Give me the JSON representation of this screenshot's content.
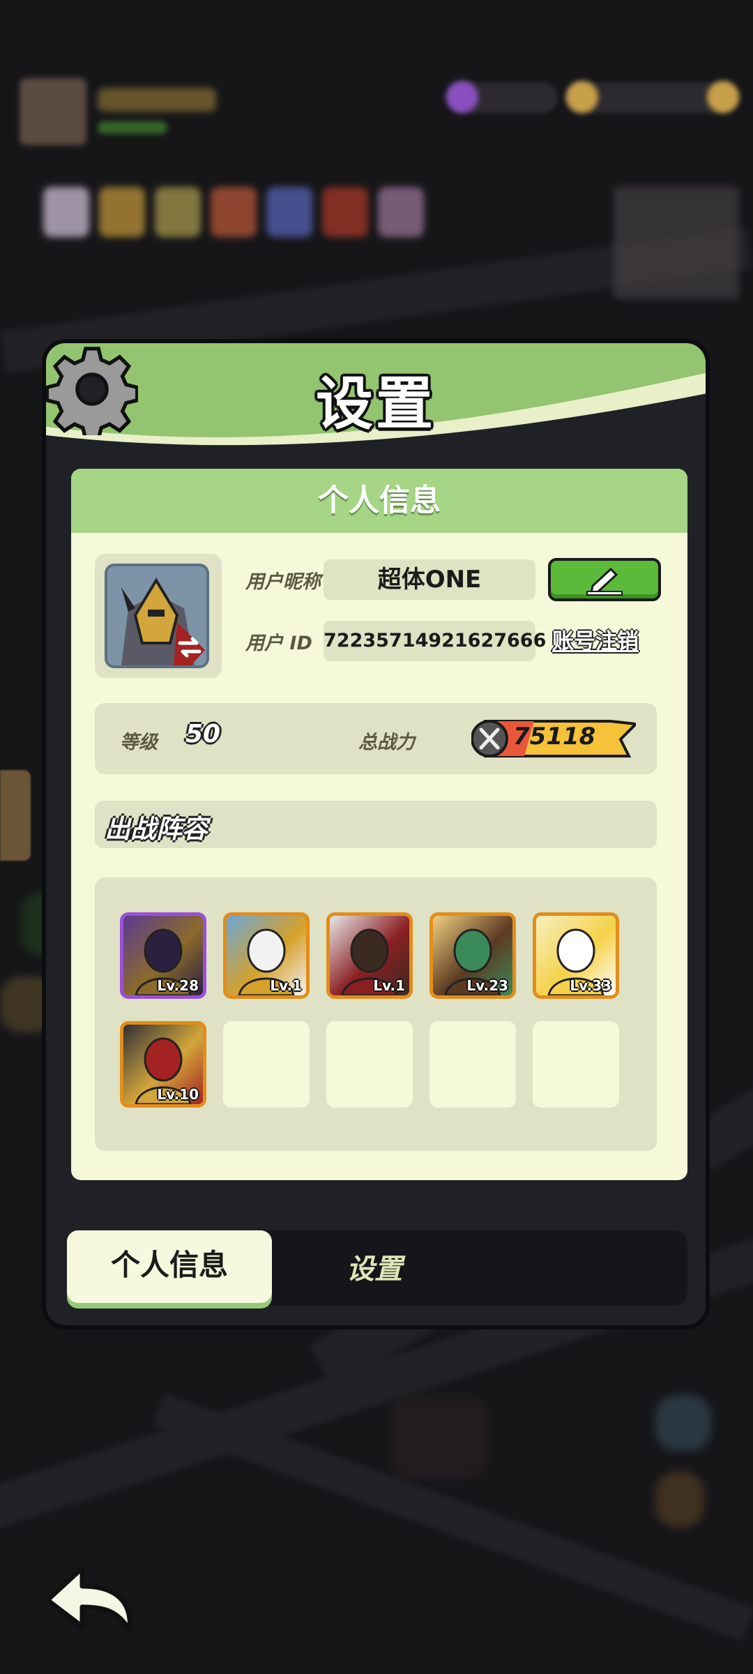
{
  "panel": {
    "title": "设置",
    "section_header": "个人信息"
  },
  "profile": {
    "nickname_label": "用户昵称",
    "nickname_value": "超体ONE",
    "id_label": "用户  ID",
    "id_value": "72235714921627666",
    "deactivate_label": "账号注销"
  },
  "stats": {
    "level_label": "等级",
    "level_value": "50",
    "power_label": "总战力",
    "power_value": "75118"
  },
  "lineup": {
    "title": "出战阵容",
    "heroes": [
      {
        "level": "Lv.28",
        "rarity": "epic",
        "palette": [
          "#5b3a8f",
          "#8b6a2b",
          "#2b2040"
        ]
      },
      {
        "level": "Lv.1",
        "rarity": "legendary",
        "palette": [
          "#6aa7d8",
          "#d6a12a",
          "#f2f2f2"
        ]
      },
      {
        "level": "Lv.1",
        "rarity": "legendary",
        "palette": [
          "#e8e8e8",
          "#8a1f22",
          "#3a2a22"
        ]
      },
      {
        "level": "Lv.23",
        "rarity": "legendary",
        "palette": [
          "#f0d080",
          "#5c3a22",
          "#3a8a5a"
        ]
      },
      {
        "level": "Lv.33",
        "rarity": "legendary",
        "palette": [
          "#f6f0c0",
          "#f5d24a",
          "#ffffff"
        ]
      },
      {
        "level": "Lv.10",
        "rarity": "legendary",
        "palette": [
          "#303038",
          "#d2a63a",
          "#a32222"
        ]
      }
    ],
    "empty_slots": 4
  },
  "tabs": {
    "active": "个人信息",
    "inactive": "设置"
  },
  "icons": {
    "gear": "gear-icon",
    "edit": "edit-pencil-icon",
    "swap": "swap-arrows-icon",
    "power": "crossed-swords-icon",
    "back": "back-arrow-icon"
  },
  "colors": {
    "header_green": "#93c46f",
    "card_bg": "#f5f8d9",
    "edit_button": "#5cba3b",
    "legendary_border": "#e38d1b",
    "epic_border": "#9b4fd8"
  }
}
